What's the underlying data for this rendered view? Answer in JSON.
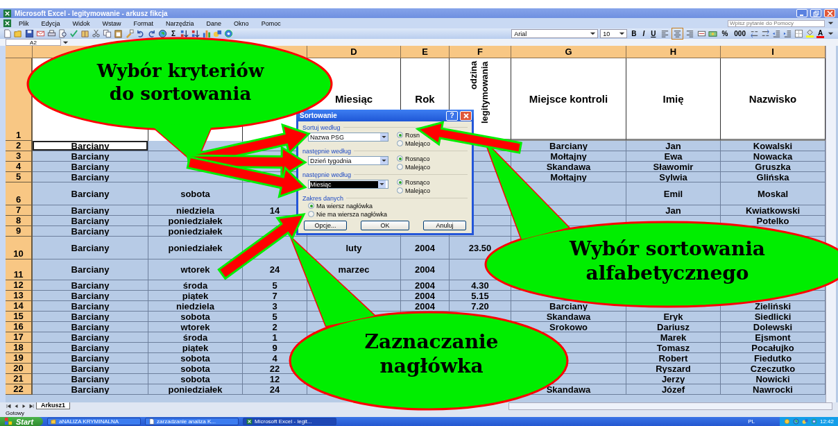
{
  "window": {
    "title": "Microsoft Excel - legitymowanie - arkusz fikcja"
  },
  "menu": [
    "Plik",
    "Edycja",
    "Widok",
    "Wstaw",
    "Format",
    "Narzędzia",
    "Dane",
    "Okno",
    "Pomoc"
  ],
  "help_box": {
    "placeholder": "Wpisz pytanie do Pomocy"
  },
  "toolbar": {
    "sum": "Σ",
    "font": "Arial",
    "font_size": "10",
    "bold": "B",
    "italic": "I",
    "underline": "U",
    "alignment": [
      {
        "selected": false
      },
      {
        "selected": true
      },
      {
        "selected": false
      }
    ],
    "percent": "%",
    "thousands": "000",
    "font_color": "A"
  },
  "name_box": {
    "value": "A2"
  },
  "sheet": {
    "columns": [
      null,
      null,
      null,
      "D",
      "E",
      "F",
      "G",
      "H",
      "I"
    ],
    "header_row": {
      "number": "1",
      "cells": [
        null,
        null,
        null,
        "Miesiąc",
        "Rok",
        "odzina legitymowania",
        "Miejsce kontroli",
        "Imię",
        "Nazwisko"
      ]
    },
    "rows": [
      {
        "number": "2",
        "active": true,
        "cells": [
          "Barciany",
          null,
          null,
          null,
          null,
          null,
          "Barciany",
          "Jan",
          "Kowalski"
        ]
      },
      {
        "number": "3",
        "active": false,
        "cells": [
          "Barciany",
          null,
          null,
          null,
          null,
          null,
          "Mołtajny",
          "Ewa",
          "Nowacka"
        ]
      },
      {
        "number": "4",
        "active": false,
        "cells": [
          "Barciany",
          null,
          null,
          null,
          null,
          null,
          "Skandawa",
          "Sławomir",
          "Gruszka"
        ]
      },
      {
        "number": "5",
        "active": false,
        "cells": [
          "Barciany",
          null,
          null,
          null,
          null,
          null,
          "Mołtajny",
          "Sylwia",
          "Glińska"
        ]
      },
      {
        "number": "6",
        "active": false,
        "cells": [
          "Barciany",
          "sobota",
          null,
          null,
          null,
          null,
          null,
          "Emil",
          "Moskal"
        ]
      },
      {
        "number": "7",
        "active": false,
        "cells": [
          "Barciany",
          "niedziela",
          "14",
          null,
          null,
          null,
          null,
          "Jan",
          "Kwiatkowski"
        ]
      },
      {
        "number": "8",
        "active": false,
        "cells": [
          "Barciany",
          "poniedziałek",
          null,
          null,
          null,
          null,
          null,
          null,
          "Potelko"
        ]
      },
      {
        "number": "9",
        "active": false,
        "cells": [
          "Barciany",
          "poniedziałek",
          null,
          null,
          null,
          null,
          null,
          null,
          null
        ]
      },
      {
        "number": "10",
        "active": false,
        "cells": [
          "Barciany",
          "poniedziałek",
          null,
          "luty",
          "2004",
          "23.50",
          null,
          null,
          null
        ]
      },
      {
        "number": "11",
        "active": false,
        "cells": [
          "Barciany",
          "wtorek",
          "24",
          "marzec",
          "2004",
          null,
          null,
          null,
          null
        ]
      },
      {
        "number": "12",
        "active": false,
        "cells": [
          "Barciany",
          "środa",
          "5",
          null,
          "2004",
          "4.30",
          null,
          null,
          null
        ]
      },
      {
        "number": "13",
        "active": false,
        "cells": [
          "Barciany",
          "piątek",
          "7",
          null,
          "2004",
          "5.15",
          null,
          null,
          null
        ]
      },
      {
        "number": "14",
        "active": false,
        "cells": [
          "Barciany",
          "niedziela",
          "3",
          null,
          "2004",
          "7.20",
          "Barciany",
          null,
          "Zieliński"
        ]
      },
      {
        "number": "15",
        "active": false,
        "cells": [
          "Barciany",
          "sobota",
          "5",
          null,
          null,
          null,
          "Skandawa",
          "Eryk",
          "Siedlicki"
        ]
      },
      {
        "number": "16",
        "active": false,
        "cells": [
          "Barciany",
          "wtorek",
          "2",
          null,
          null,
          null,
          "Srokowo",
          "Dariusz",
          "Dolewski"
        ]
      },
      {
        "number": "17",
        "active": false,
        "cells": [
          "Barciany",
          "środa",
          "1",
          null,
          null,
          null,
          null,
          "Marek",
          "Ejsmont"
        ]
      },
      {
        "number": "18",
        "active": false,
        "cells": [
          "Barciany",
          "piątek",
          "9",
          null,
          null,
          null,
          null,
          "Tomasz",
          "Pocałujko"
        ]
      },
      {
        "number": "19",
        "active": false,
        "cells": [
          "Barciany",
          "sobota",
          "4",
          null,
          null,
          null,
          null,
          "Robert",
          "Fiedutko"
        ]
      },
      {
        "number": "20",
        "active": false,
        "cells": [
          "Barciany",
          "sobota",
          "22",
          null,
          null,
          null,
          null,
          "Ryszard",
          "Czeczutko"
        ]
      },
      {
        "number": "21",
        "active": false,
        "cells": [
          "Barciany",
          "sobota",
          "12",
          null,
          null,
          null,
          null,
          "Jerzy",
          "Nowicki"
        ]
      },
      {
        "number": "22",
        "active": false,
        "cells": [
          "Barciany",
          "poniedziałek",
          "24",
          null,
          null,
          null,
          "Skandawa",
          "Józef",
          "Nawrocki"
        ]
      }
    ]
  },
  "dialog": {
    "title": "Sortowanie",
    "help": "?",
    "groups": [
      {
        "label": "Sortuj według",
        "field": "Nazwa PSG",
        "text_selected": false,
        "options": [
          {
            "label": "Rosn",
            "selected": true
          },
          {
            "label": "Malejąco",
            "selected": false
          }
        ]
      },
      {
        "label": "następnie według",
        "field": "Dzień tygodnia",
        "text_selected": false,
        "options": [
          {
            "label": "Rosnąco",
            "selected": true
          },
          {
            "label": "Malejąco",
            "selected": false
          }
        ]
      },
      {
        "label": "następnie według",
        "field": "Miesiąc",
        "text_selected": true,
        "options": [
          {
            "label": "Rosnąco",
            "selected": true
          },
          {
            "label": "Malejąco",
            "selected": false
          }
        ]
      }
    ],
    "range": {
      "label": "Zakres danych",
      "options": [
        {
          "label": "Ma wiersz nagłówka",
          "selected": true
        },
        {
          "label": "Nie ma wiersza nagłówka",
          "selected": false
        }
      ]
    },
    "buttons": [
      "Opcje...",
      "OK",
      "Anuluj"
    ]
  },
  "callouts": [
    {
      "lines": [
        "Wybór kryteriów",
        "do sortowania"
      ]
    },
    {
      "lines": [
        "Wybór sortowania",
        "alfabetycznego"
      ]
    },
    {
      "lines": [
        "Zaznaczanie",
        "nagłówka"
      ]
    }
  ],
  "sheet_tabs": [
    {
      "label": "Arkusz1",
      "selected": true
    }
  ],
  "status_bar": "Gotowy",
  "taskbar": {
    "start": "Start",
    "tasks": [
      {
        "label": "aNALIZA KRYMINALNA",
        "selected": false
      },
      {
        "label": "zarzadzanie analiza K...",
        "selected": false
      },
      {
        "label": "Microsoft Excel - legit...",
        "selected": true
      }
    ],
    "language": "PL",
    "clock": "12:42"
  }
}
